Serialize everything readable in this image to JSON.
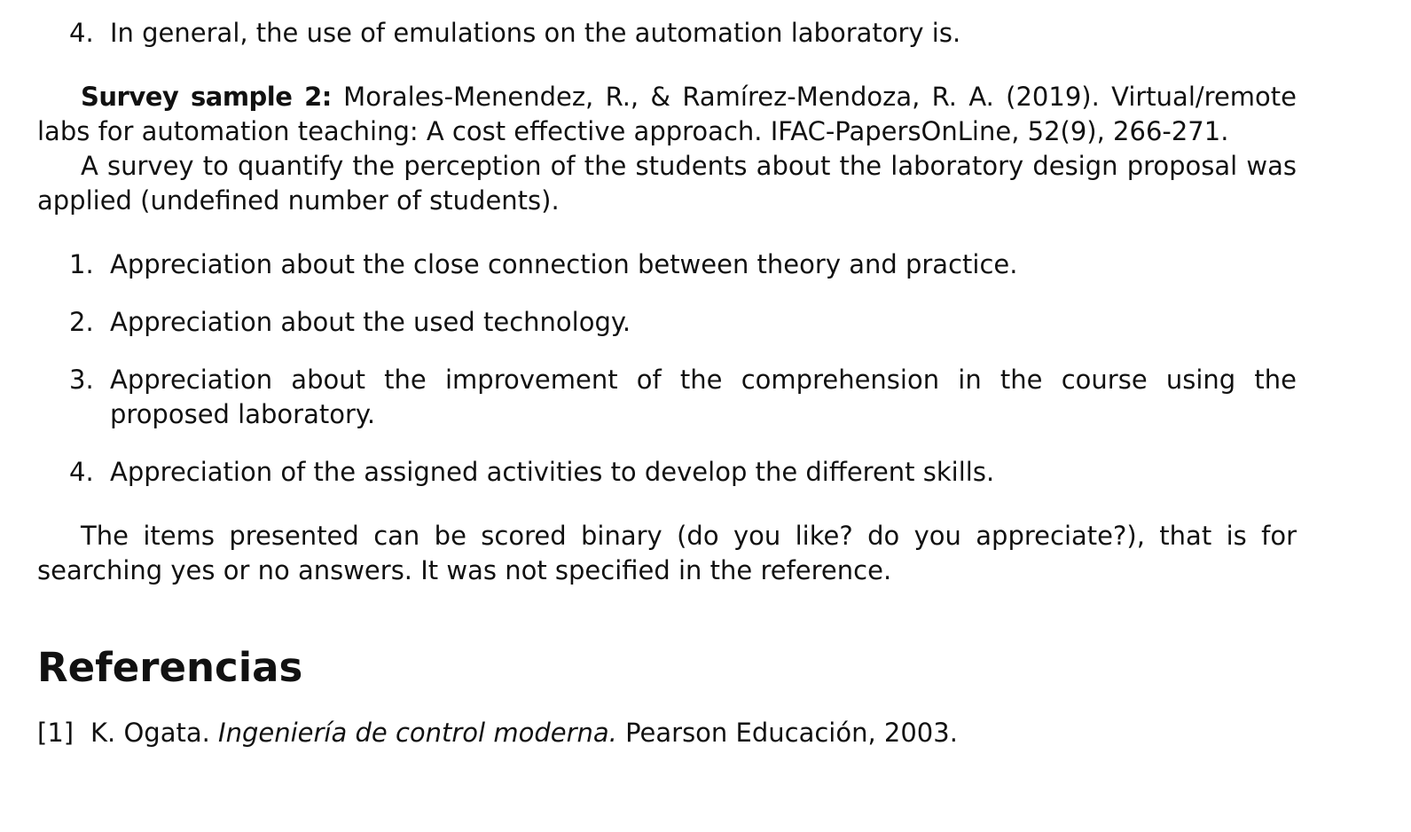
{
  "top_item": {
    "number": "4.",
    "text": "In general, the use of emulations on the automation laboratory is."
  },
  "survey": {
    "label": "Survey sample 2:",
    "citation": " Morales-Menendez, R., & Ramírez-Mendoza, R. A. (2019). Virtual/remote labs for automation teaching: A cost effective approach. IFAC-PapersOnLine, 52(9), 266-271.",
    "intro": "A survey to quantify the perception of the students about the laboratory design proposal was applied (undefined number of students)."
  },
  "items": [
    {
      "number": "1.",
      "text": "Appreciation about the close connection between theory and practice."
    },
    {
      "number": "2.",
      "text": "Appreciation about the used technology."
    },
    {
      "number": "3.",
      "text": "Appreciation about the improvement of the comprehension in the course using the proposed laboratory."
    },
    {
      "number": "4.",
      "text": "Appreciation of the assigned activities to develop the different skills."
    }
  ],
  "closing": "The items presented can be scored binary (do you like? do you appreciate?), that is for searching yes or no answers. It was not specified in the reference.",
  "references": {
    "heading": "Referencias",
    "entries": [
      {
        "number": "[1]",
        "author": "K. Ogata. ",
        "title": "Ingeniería de control moderna.",
        "rest": " Pearson Educación, 2003."
      }
    ]
  }
}
